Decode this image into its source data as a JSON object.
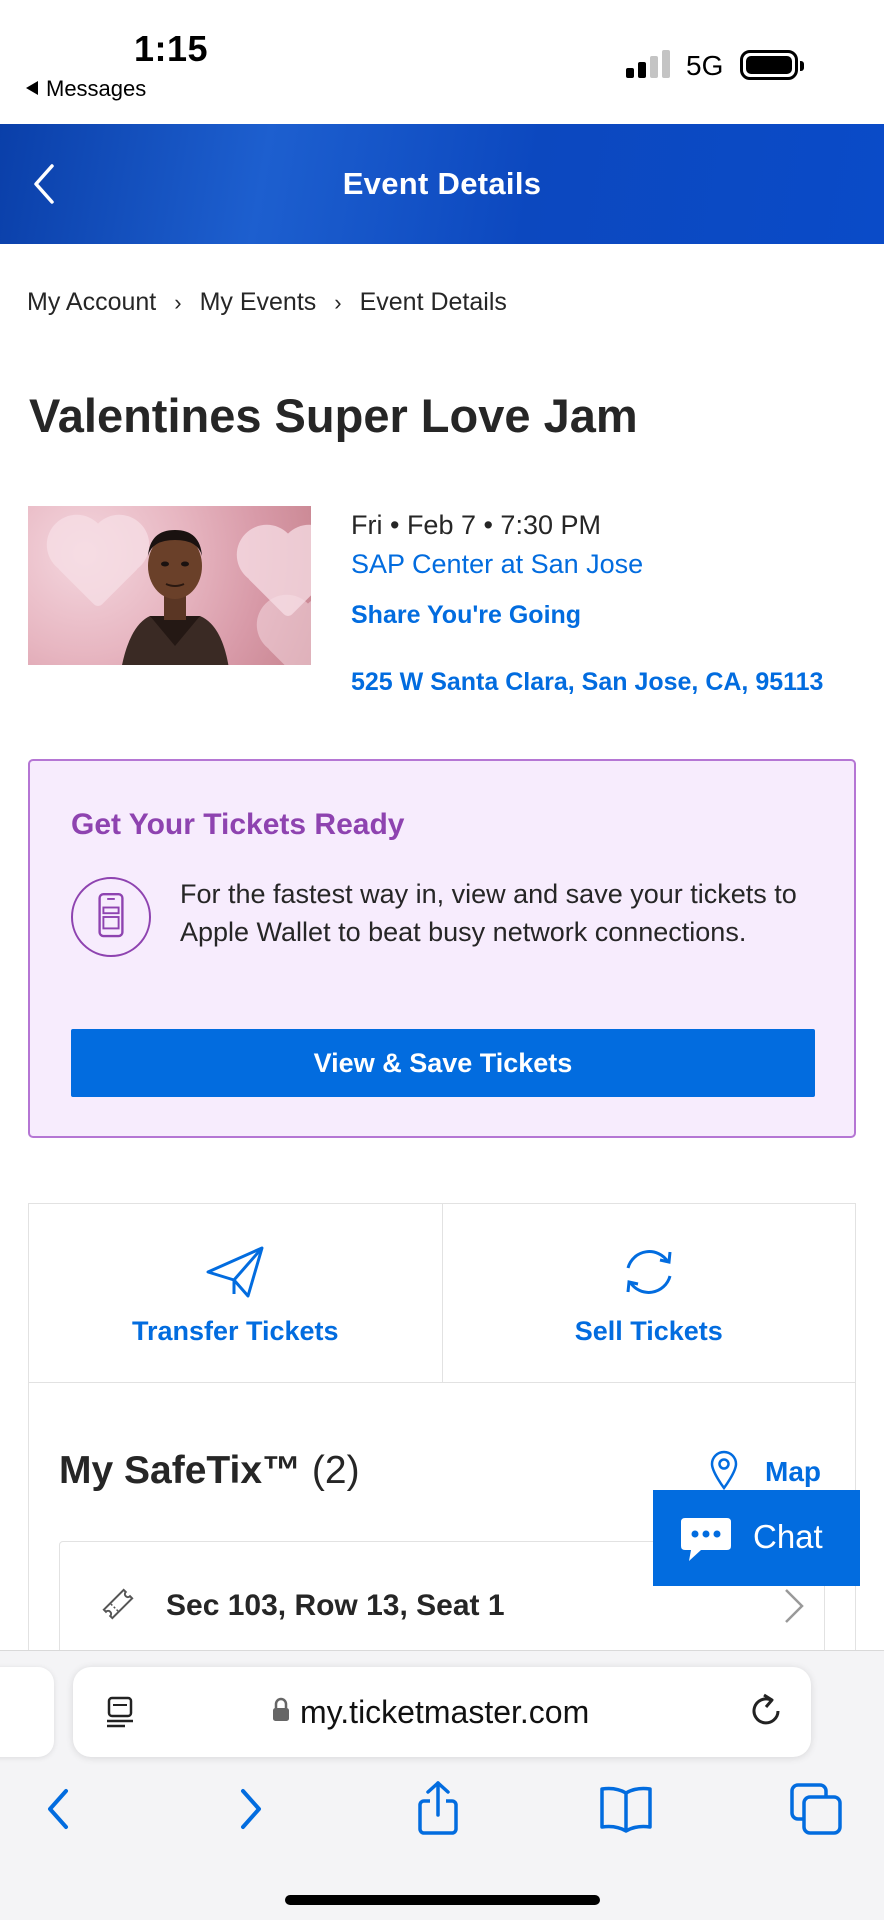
{
  "status_bar": {
    "time": "1:15",
    "back_app": "Messages",
    "network": "5G"
  },
  "header": {
    "title": "Event Details",
    "background_color": "#0a4bc8"
  },
  "breadcrumb": [
    "My Account",
    "My Events",
    "Event Details"
  ],
  "breadcrumb_separator": "›",
  "event": {
    "title": "Valentines Super Love Jam",
    "date_time": "Fri • Feb 7 • 7:30 PM",
    "venue": "SAP Center at San Jose",
    "share_label": "Share You're Going",
    "address": "525 W Santa Clara, San Jose, CA, 95113"
  },
  "ready_card": {
    "title": "Get Your Tickets Ready",
    "text": "For the fastest way in, view and save your tickets to Apple Wallet to beat busy network connections.",
    "button_label": "View & Save Tickets",
    "icon": "phone-ticket-icon"
  },
  "actions": [
    {
      "label": "Transfer Tickets",
      "icon": "paper-plane-icon"
    },
    {
      "label": "Sell Tickets",
      "icon": "refresh-arrows-icon"
    }
  ],
  "safetix": {
    "title": "My SafeTix™",
    "count": "(2)",
    "map_label": "Map",
    "ticket_label": "Sec 103, Row 13, Seat 1"
  },
  "chat": {
    "label": "Chat",
    "icon": "chat-bubble-icon"
  },
  "browser": {
    "url": "my.ticketmaster.com"
  },
  "colors": {
    "accent": "#026cdf",
    "purple": "#8e43b0",
    "card_bg": "#f7ecfd"
  }
}
